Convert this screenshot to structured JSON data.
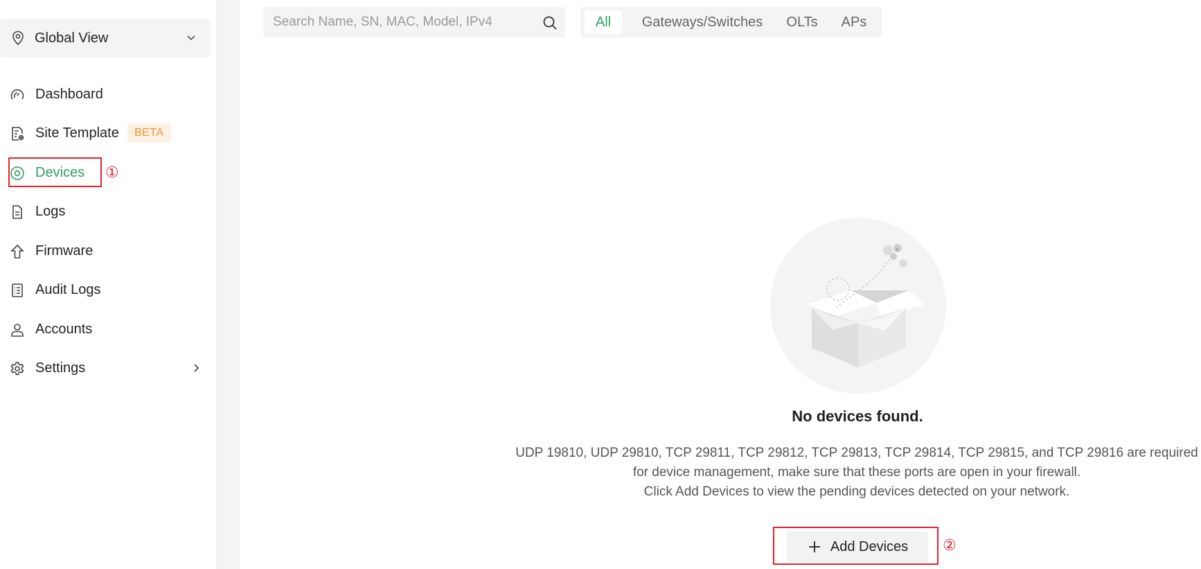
{
  "sidebar": {
    "site_selector": {
      "label": "Global View",
      "icon": "location-pin-icon"
    },
    "items": [
      {
        "label": "Dashboard",
        "icon": "gauge-icon"
      },
      {
        "label": "Site Template",
        "icon": "template-icon",
        "badge": "BETA"
      },
      {
        "label": "Devices",
        "icon": "device-icon",
        "active": true
      },
      {
        "label": "Logs",
        "icon": "document-icon"
      },
      {
        "label": "Firmware",
        "icon": "upload-arrow-icon"
      },
      {
        "label": "Audit Logs",
        "icon": "list-icon"
      },
      {
        "label": "Accounts",
        "icon": "user-icon"
      },
      {
        "label": "Settings",
        "icon": "gear-icon",
        "has_submenu": true
      }
    ]
  },
  "toolbar": {
    "search": {
      "placeholder": "Search Name, SN, MAC, Model, IPv4",
      "value": ""
    },
    "filter_tabs": [
      {
        "label": "All",
        "active": true
      },
      {
        "label": "Gateways/Switches"
      },
      {
        "label": "OLTs"
      },
      {
        "label": "APs"
      }
    ]
  },
  "empty_state": {
    "title": "No devices found.",
    "line1": "UDP 19810, UDP 29810, TCP 29811, TCP 29812, TCP 29813, TCP 29814, TCP 29815, and TCP 29816 are required",
    "line2": "for device management, make sure that these ports are open in your firewall.",
    "line3": "Click Add Devices to view the pending devices detected on your network.",
    "button_label": "Add Devices"
  },
  "annotations": {
    "step1": "①",
    "step2": "②",
    "color": "#e8202a"
  },
  "colors": {
    "accent": "#2f9e63",
    "beta_text": "#f0922f",
    "beta_bg": "#fdf1e3"
  }
}
